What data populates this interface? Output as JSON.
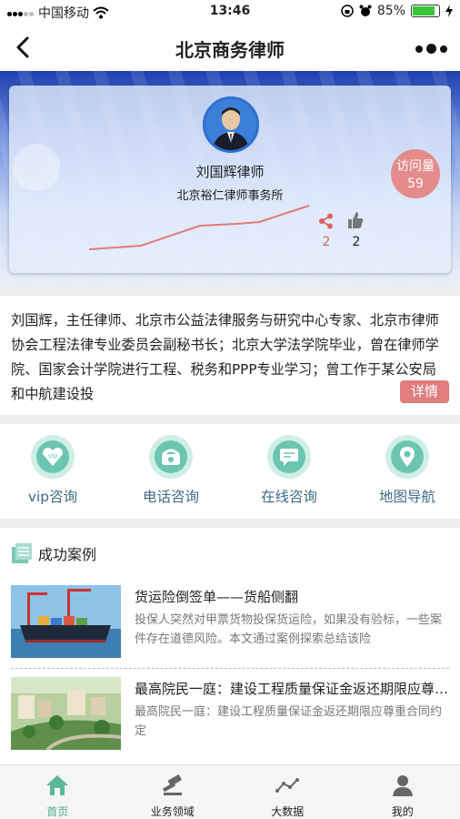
{
  "status_bar": {
    "carrier": "中国移动",
    "time": "13:46",
    "battery": "85%"
  },
  "nav": {
    "title": "北京商务律师"
  },
  "profile": {
    "name": "刘国辉律师",
    "firm": "北京裕仁律师事务所",
    "visit_label": "访问量",
    "visit_count": "59",
    "share_count": "2",
    "like_count": "2"
  },
  "intro": {
    "text": "刘国辉，主任律师、北京市公益法律服务与研究中心专家、北京市律师协会工程法律专业委员会副秘书长；北京大学法学院毕业，曾在律师学院、国家会计学院进行工程、税务和PPP专业学习；曾工作于某公安局和中航建设投",
    "detail_button": "详情"
  },
  "actions": [
    {
      "label": "vip咨询",
      "icon": "vip-icon"
    },
    {
      "label": "电话咨询",
      "icon": "phone-icon"
    },
    {
      "label": "在线咨询",
      "icon": "chat-icon"
    },
    {
      "label": "地图导航",
      "icon": "map-pin-icon"
    }
  ],
  "cases": {
    "title": "成功案例",
    "items": [
      {
        "title": "货运险倒签单——货船侧翻",
        "desc": "投保人突然对甲票货物投保货运险，如果没有验标，一些案件存在道德风险。本文通过案例探索总结该险"
      },
      {
        "title": "最高院民一庭：建设工程质量保证金返还期限应尊重合同约定",
        "desc": "最高院民一庭：建设工程质量保证金返还期限应尊重合同约定"
      }
    ]
  },
  "tabbar": [
    {
      "label": "首页",
      "icon": "home-icon",
      "active": true
    },
    {
      "label": "业务领域",
      "icon": "gavel-icon",
      "active": false
    },
    {
      "label": "大数据",
      "icon": "trend-icon",
      "active": false
    },
    {
      "label": "我的",
      "icon": "user-icon",
      "active": false
    }
  ],
  "colors": {
    "accent": "#e07d7d",
    "teal": "#6cc5b0",
    "active_tab": "#4caf8a"
  }
}
